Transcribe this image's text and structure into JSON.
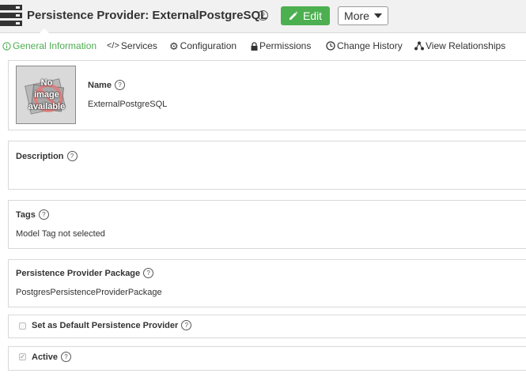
{
  "header": {
    "title": "Persistence Provider: ExternalPostgreSQL",
    "edit_label": "Edit",
    "more_label": "More",
    "accent_color": "#4caf50"
  },
  "tabs": [
    {
      "label": "General Information",
      "icon": "info-circle-icon",
      "active": true
    },
    {
      "label": "Services",
      "icon": "code-icon",
      "active": false
    },
    {
      "label": "Configuration",
      "icon": "gear-icon",
      "active": false
    },
    {
      "label": "Permissions",
      "icon": "lock-icon",
      "active": false
    },
    {
      "label": "Change History",
      "icon": "clock-icon",
      "active": false
    },
    {
      "label": "View Relationships",
      "icon": "network-icon",
      "active": false
    }
  ],
  "name_section": {
    "image_lines": [
      "No",
      "image",
      "available"
    ],
    "label": "Name",
    "value": "ExternalPostgreSQL"
  },
  "description_section": {
    "label": "Description"
  },
  "tags_section": {
    "label": "Tags",
    "value": "Model Tag not selected"
  },
  "package_section": {
    "label": "Persistence Provider Package",
    "value": "PostgresPersistenceProviderPackage"
  },
  "default_section": {
    "label": "Set as Default Persistence Provider",
    "checked": false
  },
  "active_section": {
    "label": "Active",
    "checked": true
  },
  "help_glyph": "?"
}
